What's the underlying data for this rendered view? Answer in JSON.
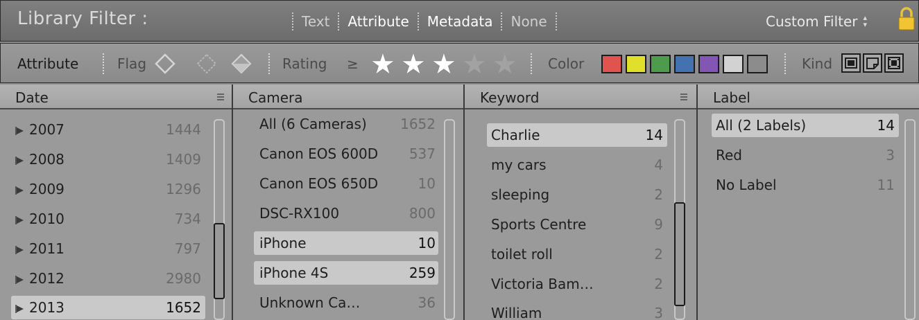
{
  "topbar": {
    "title": "Library Filter :",
    "tabs": [
      {
        "label": "Text",
        "active": false
      },
      {
        "label": "Attribute",
        "active": true
      },
      {
        "label": "Metadata",
        "active": true
      },
      {
        "label": "None",
        "active": false
      }
    ],
    "custom_filter": "Custom Filter",
    "lock_icon": "lock-icon"
  },
  "attribute_bar": {
    "label": "Attribute",
    "flag_label": "Flag",
    "rating_label": "Rating",
    "rating_operator": "≥",
    "rating_value": 3,
    "rating_max": 5,
    "color_label": "Color",
    "colors": [
      "#e0534f",
      "#e0df2c",
      "#4f9b4d",
      "#4471b0",
      "#8456b4",
      "#d2d2d2",
      "#8c8c8c"
    ],
    "kind_label": "Kind"
  },
  "columns": {
    "date": {
      "header": "Date",
      "rows": [
        {
          "label": "2007",
          "count": "1444"
        },
        {
          "label": "2008",
          "count": "1409"
        },
        {
          "label": "2009",
          "count": "1296"
        },
        {
          "label": "2010",
          "count": "734"
        },
        {
          "label": "2011",
          "count": "797"
        },
        {
          "label": "2012",
          "count": "2980"
        },
        {
          "label": "2013",
          "count": "1652"
        }
      ]
    },
    "camera": {
      "header": "Camera",
      "rows": [
        {
          "label": "All (6 Cameras)",
          "count": "1652"
        },
        {
          "label": "Canon EOS 600D",
          "count": "537"
        },
        {
          "label": "Canon EOS 650D",
          "count": "10"
        },
        {
          "label": "DSC-RX100",
          "count": "800"
        },
        {
          "label": "iPhone",
          "count": "10"
        },
        {
          "label": "iPhone 4S",
          "count": "259"
        },
        {
          "label": "Unknown Ca…",
          "count": "36"
        }
      ]
    },
    "keyword": {
      "header": "Keyword",
      "rows": [
        {
          "label": "Charlie",
          "count": "14"
        },
        {
          "label": "my cars",
          "count": "4"
        },
        {
          "label": "sleeping",
          "count": "2"
        },
        {
          "label": "Sports Centre",
          "count": "9"
        },
        {
          "label": "toilet roll",
          "count": "2"
        },
        {
          "label": "Victoria Bam…",
          "count": "2"
        },
        {
          "label": "William",
          "count": "3"
        }
      ]
    },
    "label": {
      "header": "Label",
      "rows": [
        {
          "label": "All (2 Labels)",
          "count": "14"
        },
        {
          "label": "Red",
          "count": "3"
        },
        {
          "label": "No Label",
          "count": "11"
        }
      ]
    }
  }
}
